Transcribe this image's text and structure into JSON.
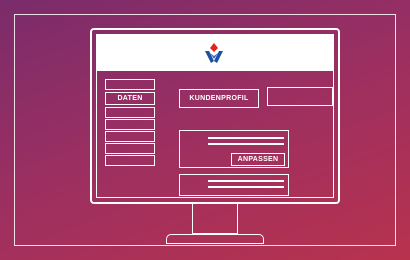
{
  "sidebar": {
    "active_label": "DATEN"
  },
  "main": {
    "profile_button": "KUNDENPROFIL",
    "adjust_button": "ANPASSEN"
  },
  "colors": {
    "bg_start": "#7a2c6b",
    "bg_end": "#b8324e",
    "line": "#ffffff",
    "logo_red": "#e2231a",
    "logo_blue": "#1f4fa0"
  },
  "icons": {
    "logo": "brand-logo-icon",
    "monitor": "monitor-icon"
  }
}
